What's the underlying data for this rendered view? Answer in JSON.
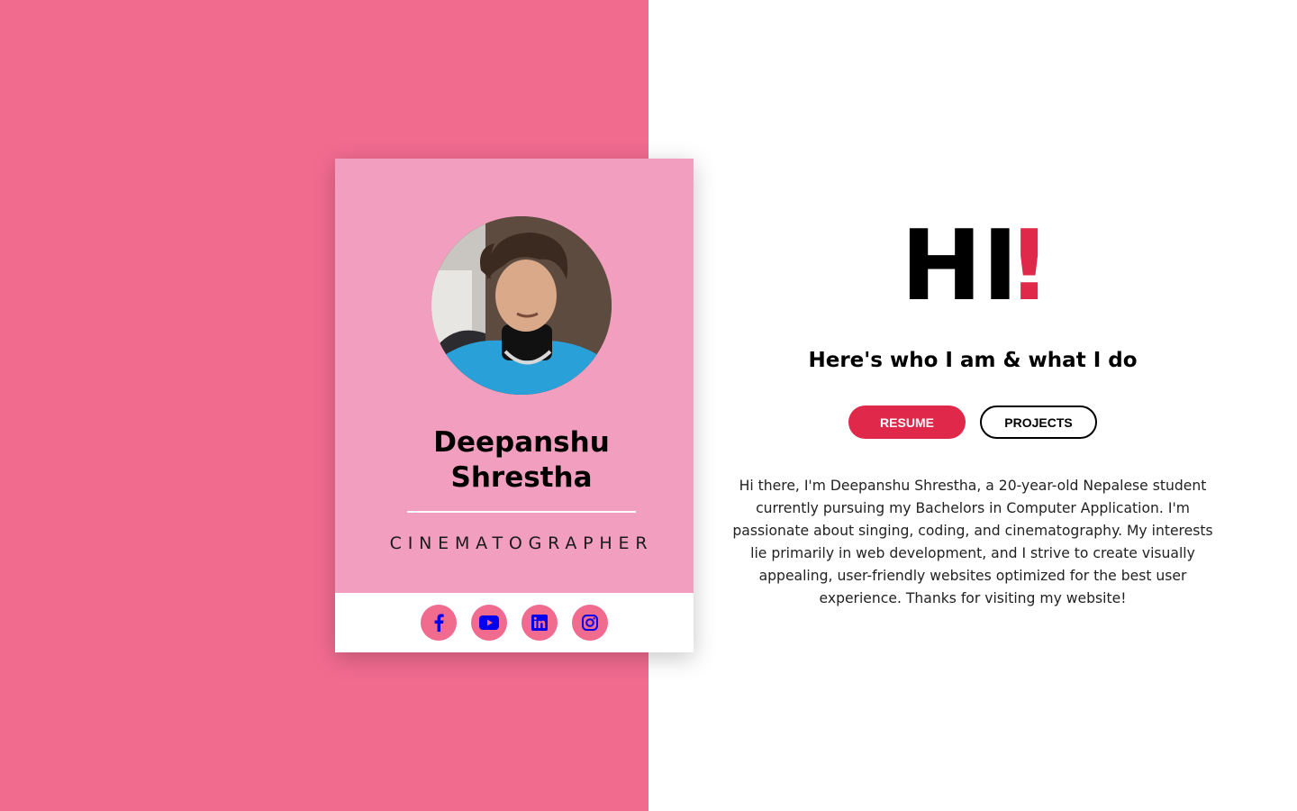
{
  "theme": {
    "left_panel_color": "#f16b8f",
    "card_color": "#f29ebe",
    "accent_color": "#e0284a",
    "social_icon_color": "#0000ee"
  },
  "profile": {
    "avatar_alt": "Profile photo",
    "name_line1": "Deepanshu",
    "name_line2": "Shrestha",
    "role": "CINEMATOGRAPHER"
  },
  "social": [
    {
      "icon": "facebook-icon"
    },
    {
      "icon": "youtube-icon"
    },
    {
      "icon": "linkedin-icon"
    },
    {
      "icon": "instagram-icon"
    }
  ],
  "hero": {
    "greeting": "HI",
    "exclamation": "!",
    "tagline": "Here's who I am & what I do"
  },
  "buttons": {
    "resume": "RESUME",
    "projects": "PROJECTS"
  },
  "bio": "Hi there, I'm Deepanshu Shrestha, a 20-year-old Nepalese student currently pursuing my Bachelors in Computer Application. I'm passionate about singing, coding, and cinematography. My interests lie primarily in web development, and I strive to create visually appealing, user-friendly websites optimized for the best user experience. Thanks for visiting my website!"
}
